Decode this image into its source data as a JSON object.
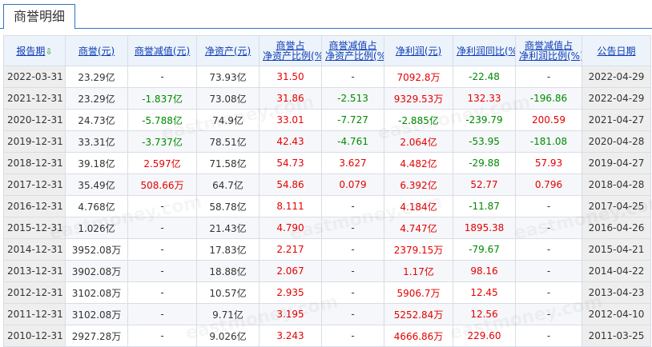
{
  "tab": {
    "label": "商誉明细"
  },
  "columns": [
    {
      "label": "报告期",
      "sort_icon": "sort-down-arrow-icon"
    },
    {
      "label": "商誉(元)"
    },
    {
      "label": "商誉减值(元)"
    },
    {
      "label": "净资产(元)"
    },
    {
      "label": "商誉占",
      "label2": "净资产比例(%)"
    },
    {
      "label": "商誉减值占",
      "label2": "净资产比例(%)"
    },
    {
      "label": "净利润(元)"
    },
    {
      "label": "净利润同比(%)"
    },
    {
      "label": "商誉减值占",
      "label2": "净利润比例(%)"
    },
    {
      "label": "公告日期"
    }
  ],
  "rows": [
    [
      "2022-03-31",
      "23.29亿",
      "-",
      "73.93亿",
      "31.50",
      "-",
      "7092.8万",
      "-22.48",
      "-",
      "2022-04-29"
    ],
    [
      "2021-12-31",
      "23.29亿",
      "-1.837亿",
      "73.08亿",
      "31.86",
      "-2.513",
      "9329.53万",
      "132.33",
      "-196.86",
      "2022-04-29"
    ],
    [
      "2020-12-31",
      "24.73亿",
      "-5.788亿",
      "74.9亿",
      "33.01",
      "-7.727",
      "-2.885亿",
      "-239.79",
      "200.59",
      "2021-04-27"
    ],
    [
      "2019-12-31",
      "33.31亿",
      "-3.737亿",
      "78.51亿",
      "42.43",
      "-4.761",
      "2.064亿",
      "-53.95",
      "-181.08",
      "2020-04-28"
    ],
    [
      "2018-12-31",
      "39.18亿",
      "2.597亿",
      "71.58亿",
      "54.73",
      "3.627",
      "4.482亿",
      "-29.88",
      "57.93",
      "2019-04-27"
    ],
    [
      "2017-12-31",
      "35.49亿",
      "508.66万",
      "64.7亿",
      "54.86",
      "0.079",
      "6.392亿",
      "52.77",
      "0.796",
      "2018-04-28"
    ],
    [
      "2016-12-31",
      "4.768亿",
      "-",
      "58.78亿",
      "8.111",
      "-",
      "4.184亿",
      "-11.87",
      "-",
      "2017-04-25"
    ],
    [
      "2015-12-31",
      "1.026亿",
      "-",
      "21.43亿",
      "4.790",
      "-",
      "4.747亿",
      "1895.38",
      "-",
      "2016-04-26"
    ],
    [
      "2014-12-31",
      "3952.08万",
      "-",
      "17.83亿",
      "2.217",
      "-",
      "2379.15万",
      "-79.67",
      "-",
      "2015-04-21"
    ],
    [
      "2013-12-31",
      "3902.08万",
      "-",
      "18.88亿",
      "2.067",
      "-",
      "1.17亿",
      "98.16",
      "-",
      "2014-04-22"
    ],
    [
      "2012-12-31",
      "3102.08万",
      "-",
      "10.57亿",
      "2.935",
      "-",
      "5906.7万",
      "12.45",
      "-",
      "2013-04-23"
    ],
    [
      "2011-12-31",
      "3102.08万",
      "-",
      "9.71亿",
      "3.195",
      "-",
      "5252.84万",
      "12.56",
      "-",
      "2012-04-10"
    ],
    [
      "2010-12-31",
      "2927.28万",
      "-",
      "9.026亿",
      "3.243",
      "-",
      "4666.86万",
      "229.60",
      "-",
      "2011-03-25"
    ]
  ],
  "colors": {
    "red": "#e60000",
    "green": "#008a00",
    "link": "#0b3bb5",
    "tab_border": "#2d75c6"
  }
}
